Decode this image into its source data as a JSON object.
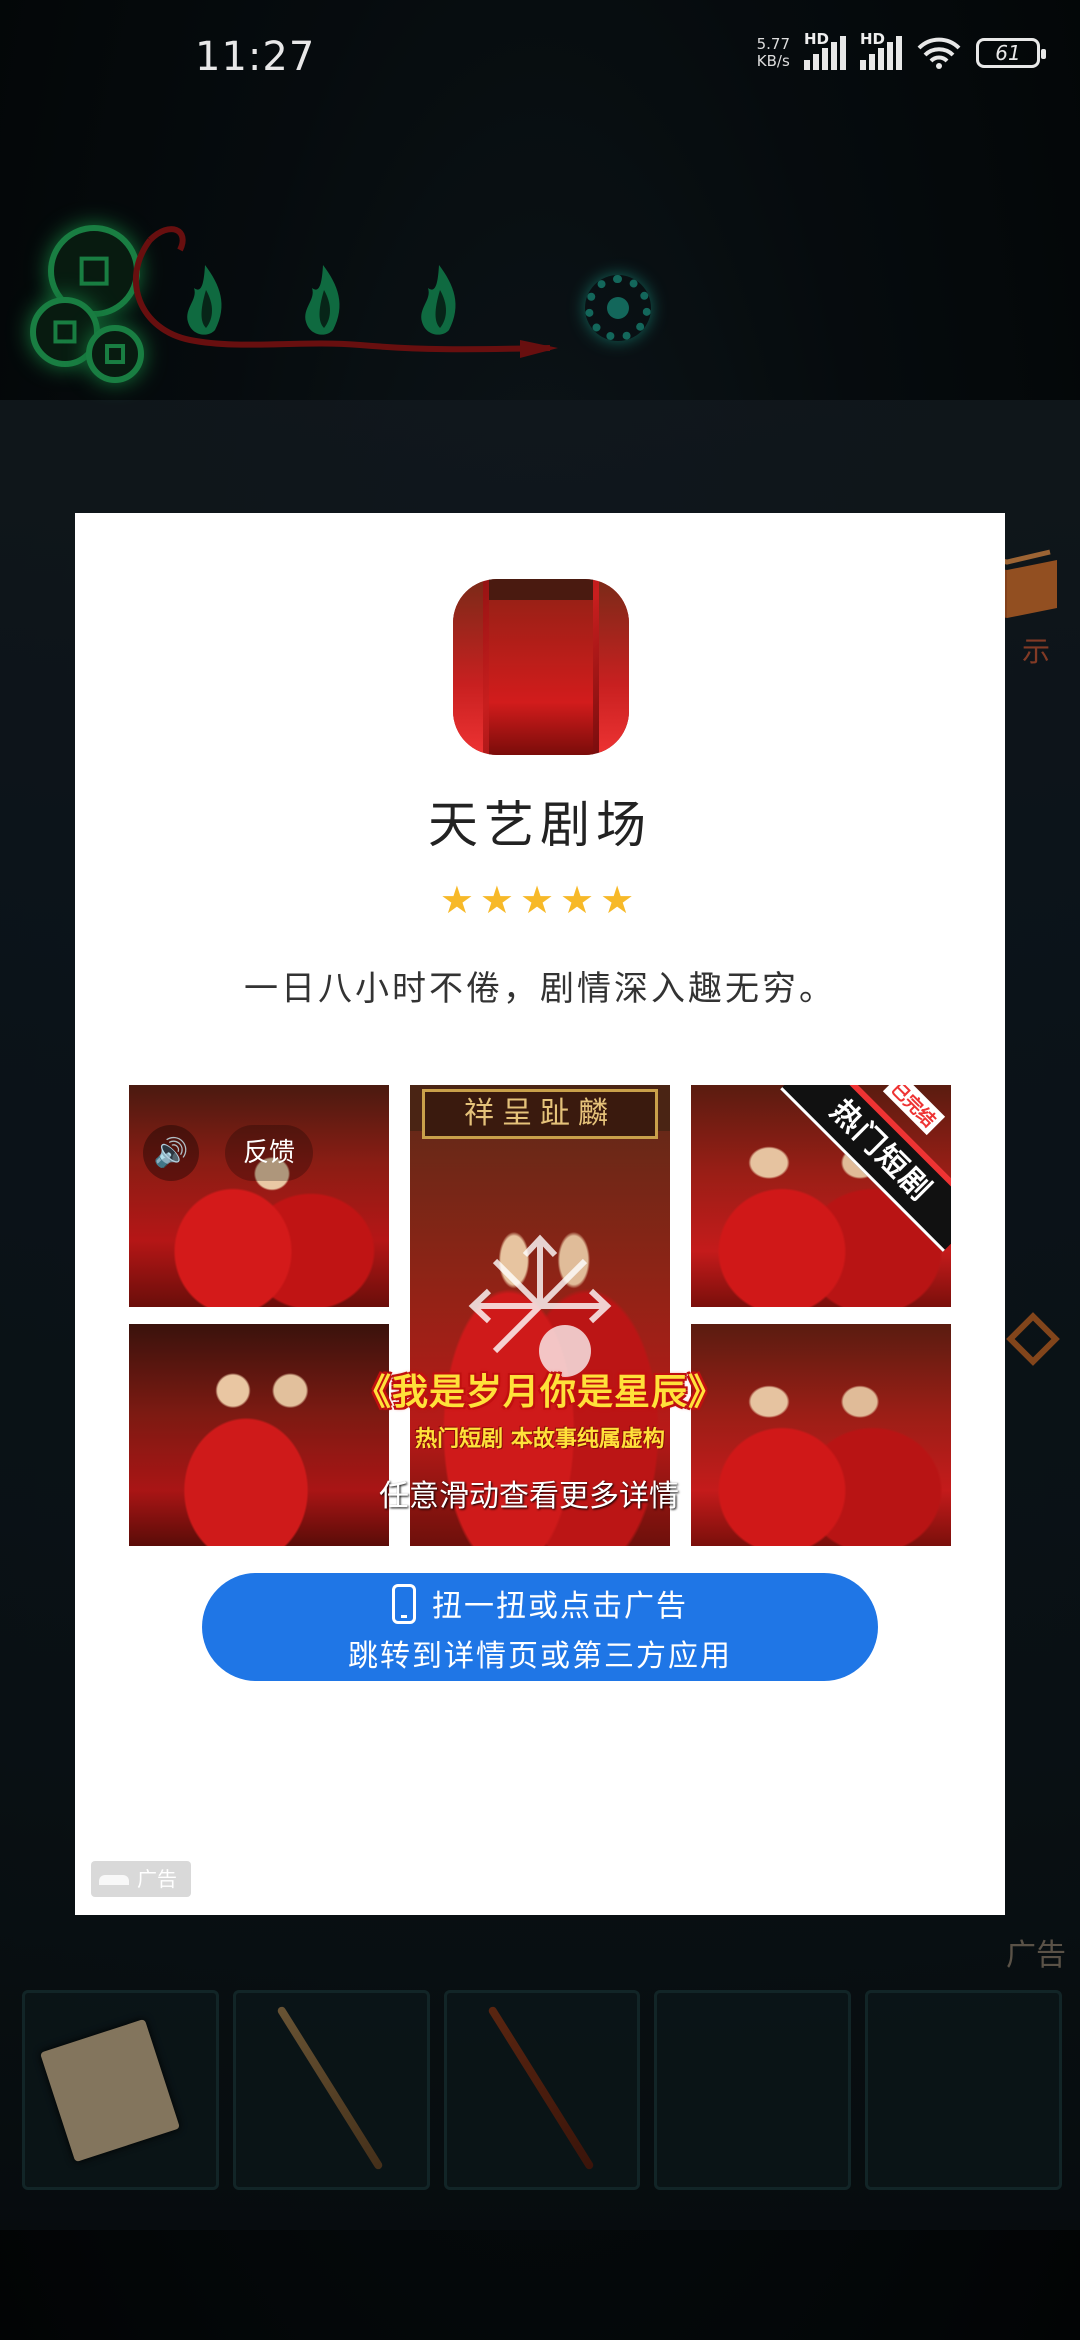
{
  "status_bar": {
    "time": "11:27",
    "net_speed_value": "5.77",
    "net_speed_unit": "KB/s",
    "signal_1_label": "HD",
    "signal_2_label": "HD",
    "battery": "61"
  },
  "game": {
    "side_text_top": "示",
    "side_text_ad": "广告"
  },
  "ad": {
    "app_name": "天艺剧场",
    "rating_stars": "★★★★★",
    "rating": 5,
    "description": "一日八小时不倦，剧情深入趣无穷。",
    "sound_icon": "🔊",
    "feedback_label": "反馈",
    "sign_text": "祥呈趾麟",
    "ribbon_main": "热门短剧",
    "ribbon_tag": "已完结",
    "drama_title": "《我是岁月你是星辰》",
    "drama_subtitle": "热门短剧  本故事纯属虚构",
    "swipe_hint": "任意滑动查看更多详情",
    "cta_line1": "扭一扭或点击广告",
    "cta_line2": "跳转到详情页或第三方应用",
    "badge_label": "广告"
  },
  "colors": {
    "cta_blue": "#1f76e6",
    "star_gold": "#f7b928",
    "glow_green": "#27c266"
  }
}
